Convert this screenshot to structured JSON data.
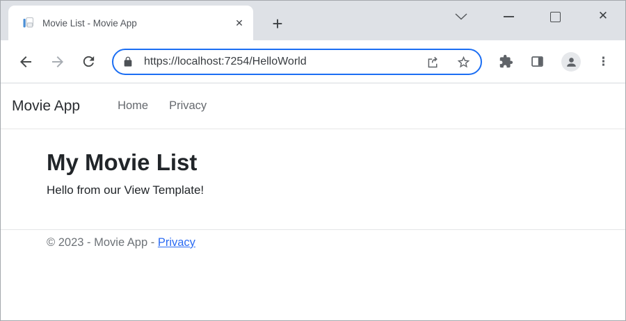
{
  "browser": {
    "tab_title": "Movie List - Movie App",
    "url": "https://localhost:7254/HelloWorld",
    "glyphs": {
      "tab_close": "✕",
      "new_tab": "+",
      "window_close": "✕",
      "menu_dots": "⋮"
    },
    "icons": {
      "favicon": "aspnet-document-with-blue-bar",
      "back": "left-arrow",
      "forward": "right-arrow-disabled",
      "reload": "circular-arrow",
      "lock": "padlock",
      "share": "arrow-out-of-box",
      "bookmark": "star-outline",
      "extensions": "puzzle-piece",
      "side_panel": "split-rectangle",
      "profile": "person-in-circle",
      "menu": "three-dots-vertical",
      "tab_search": "chevron-down",
      "minimize": "horizontal-line",
      "maximize": "square-outline"
    },
    "colors": {
      "titlebar_bg": "#dee1e6",
      "focus_ring": "#1b6ef3",
      "icon_gray": "#5f6368",
      "link_blue": "#2b6bf3",
      "muted_text": "#6d7277"
    }
  },
  "page": {
    "navbar": {
      "brand": "Movie App",
      "links": [
        {
          "label": "Home"
        },
        {
          "label": "Privacy"
        }
      ]
    },
    "main": {
      "heading": "My Movie List",
      "paragraph": "Hello from our View Template!"
    },
    "footer": {
      "text_prefix": "© 2023 - Movie App - ",
      "link_label": "Privacy"
    }
  }
}
